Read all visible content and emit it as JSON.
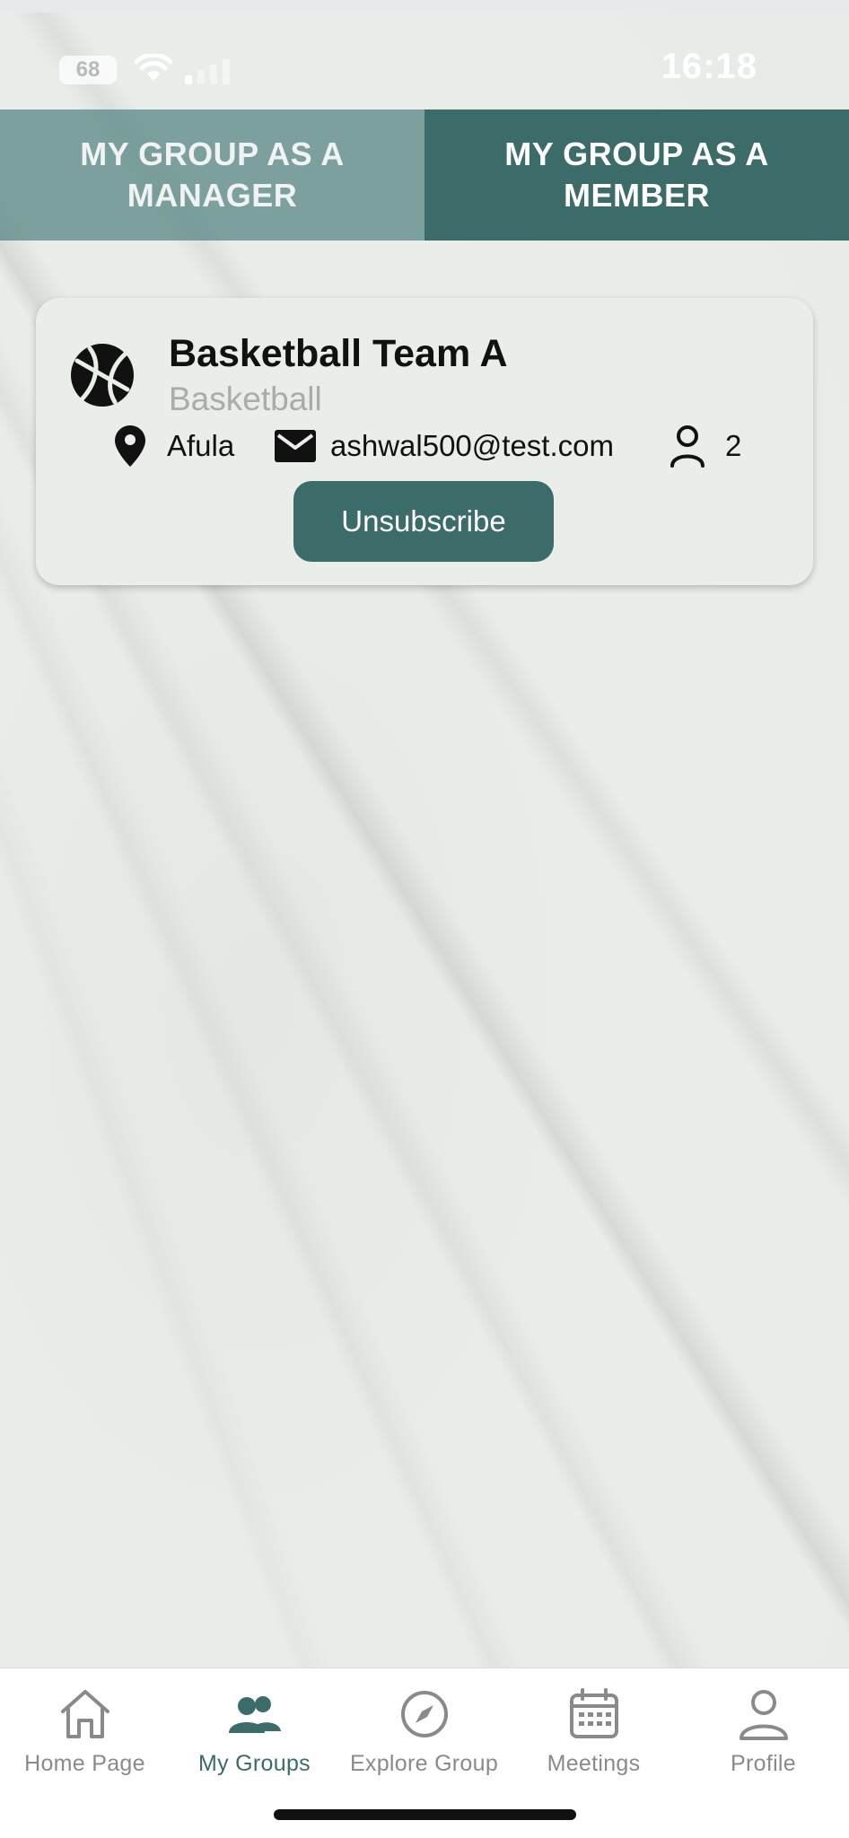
{
  "status_bar": {
    "battery": "68",
    "time": "16:18"
  },
  "tabs": [
    {
      "label": "MY GROUP AS A MANAGER",
      "active": false
    },
    {
      "label": "MY GROUP AS A MEMBER",
      "active": true
    }
  ],
  "group_card": {
    "icon": "basketball-icon",
    "title": "Basketball Team A",
    "category": "Basketball",
    "city": "Afula",
    "email": "ashwal500@test.com",
    "member_count": "2",
    "unsubscribe_label": "Unsubscribe"
  },
  "bottom_nav": {
    "items": [
      {
        "label": "Home Page",
        "icon": "home-icon",
        "active": false
      },
      {
        "label": "My Groups",
        "icon": "groups-icon",
        "active": true
      },
      {
        "label": "Explore Group",
        "icon": "compass-icon",
        "active": false
      },
      {
        "label": "Meetings",
        "icon": "calendar-icon",
        "active": false
      },
      {
        "label": "Profile",
        "icon": "person-icon",
        "active": false
      }
    ]
  },
  "colors": {
    "accent": "#3c6c6a",
    "inactive_tab": "#7fa19f",
    "card_bg": "#e9eee8",
    "nav_inactive": "#8a8a8a"
  }
}
